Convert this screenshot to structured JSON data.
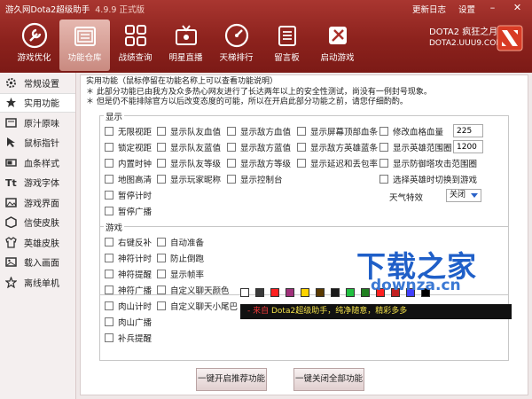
{
  "window": {
    "title": "游久网Dota2超级助手",
    "version": "4.9.9",
    "edition": "正式版",
    "update_log": "更新日志",
    "settings": "设置"
  },
  "nav": [
    {
      "label": "游戏优化",
      "icon": "wrench-icon"
    },
    {
      "label": "功能仓库",
      "icon": "warehouse-icon"
    },
    {
      "label": "战绩查询",
      "icon": "grid-icon"
    },
    {
      "label": "明星直播",
      "icon": "broadcast-icon"
    },
    {
      "label": "天梯排行",
      "icon": "gauge-icon"
    },
    {
      "label": "留言板",
      "icon": "notes-icon"
    },
    {
      "label": "启动游戏",
      "icon": "power-icon"
    }
  ],
  "brand": {
    "line1": "DOTA2 疯狂之月",
    "line2": "DOTA2.UUU9.COM"
  },
  "sidebar": [
    {
      "label": "常规设置",
      "icon": "gear-icon"
    },
    {
      "label": "实用功能",
      "icon": "star-icon"
    },
    {
      "label": "原汁原味",
      "icon": "cup-icon"
    },
    {
      "label": "鼠标指针",
      "icon": "pointer-icon"
    },
    {
      "label": "血条样式",
      "icon": "bar-icon"
    },
    {
      "label": "游戏字体",
      "icon": "font-icon"
    },
    {
      "label": "游戏界面",
      "icon": "picture-icon"
    },
    {
      "label": "信使皮肤",
      "icon": "cube-icon"
    },
    {
      "label": "英雄皮肤",
      "icon": "shirt-icon"
    },
    {
      "label": "载入画面",
      "icon": "image-icon"
    },
    {
      "label": "离线单机",
      "icon": "star-outline-icon"
    }
  ],
  "description": {
    "line1": "实用功能（鼠标停留在功能名称上可以查看功能说明）",
    "line2": "＊ 此部分功能已由我方及众多热心网友进行了长达两年以上的安全性测试，尚没有一例封号现象。",
    "line3": "＊ 但是仍不能排除官方以后改变态度的可能，所以在开启此部分功能之前，请您仔细酌酌。"
  },
  "display": {
    "title": "显示",
    "items": [
      "无限视距",
      "锁定视距",
      "内置时钟",
      "地图高清",
      "暂停计时",
      "暂停广播",
      "显示队友血值",
      "显示队友蓝值",
      "显示队友等级",
      "显示玩家昵称",
      "显示敌方血值",
      "显示敌方蓝值",
      "显示敌方等级",
      "显示控制台",
      "显示屏幕顶部血条",
      "显示敌方英雄蓝条",
      "显示延迟和丢包率",
      "修改血格血量",
      "显示英雄范围圈",
      "显示防御塔攻击范围圈",
      "选择英雄时切换到游戏"
    ],
    "blood_value": "225",
    "range_value": "1200",
    "weather_label": "天气特效",
    "weather_value": "关闭"
  },
  "game": {
    "title": "游戏",
    "items": [
      "右键反补",
      "神符计时",
      "神符提醒",
      "神符广播",
      "肉山计时",
      "肉山广播",
      "补兵提醒",
      "自动准备",
      "防止倒跑",
      "显示帧率",
      "自定义聊天颜色",
      "自定义聊天小尾巴"
    ],
    "swatch_colors": [
      "#ffffff",
      "#3a3a3a",
      "#ff2020",
      "#a0307a",
      "#ffd400",
      "#5a3a00",
      "#1a1a1a",
      "#20c040",
      "#208020",
      "#ff2020",
      "#c02020",
      "#4040ff",
      "#000000"
    ],
    "chat_prefix": "- 来自",
    "chat_text": "Dota2超级助手，纯净随意，精彩多多"
  },
  "buttons": {
    "enable": "一键开启推荐功能",
    "disable": "一键关闭全部功能"
  },
  "watermark": {
    "logo": "下载之家",
    "site": "downza.cn"
  }
}
